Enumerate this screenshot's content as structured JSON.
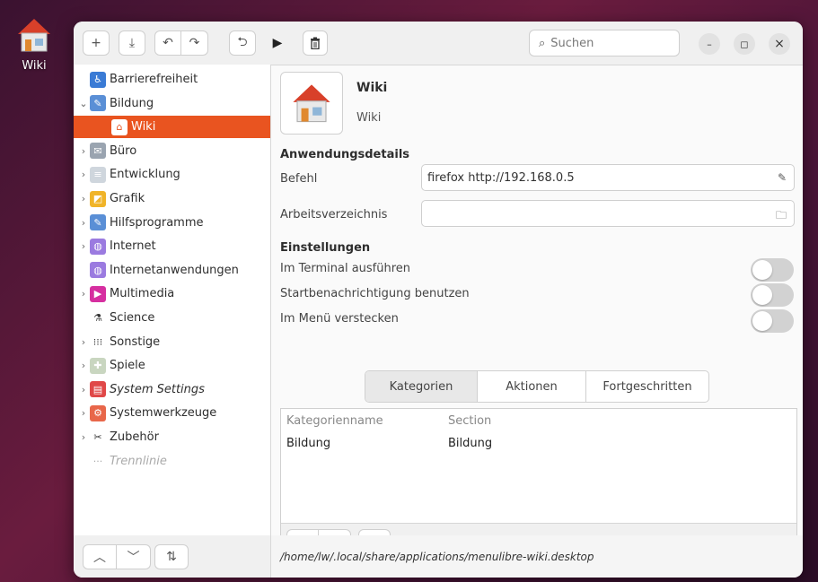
{
  "desktop": {
    "icon_label": "Wiki"
  },
  "toolbar": {
    "add": "+",
    "save": "⤓",
    "undo": "↶",
    "redo": "↷",
    "revert": "⮌",
    "run": "▶",
    "delete": "🗑",
    "search_placeholder": "Suchen",
    "minimize": "–",
    "maximize": "◻",
    "close": "×"
  },
  "sidebar": {
    "items": [
      {
        "label": "Barrierefreiheit",
        "arrow": "",
        "icon": "accessibility-icon",
        "color": "#3a7bd5",
        "glyph": "♿"
      },
      {
        "label": "Bildung",
        "arrow": "⌄",
        "icon": "education-icon",
        "color": "#5a8fd6",
        "glyph": "✎"
      },
      {
        "label": "Wiki",
        "arrow": "",
        "icon": "wiki-house-icon",
        "color": "#ffffff",
        "glyph": "⌂",
        "selected": true
      },
      {
        "label": "Büro",
        "arrow": "›",
        "icon": "office-icon",
        "color": "#9aa4b0",
        "glyph": "✉"
      },
      {
        "label": "Entwicklung",
        "arrow": "›",
        "icon": "development-icon",
        "color": "#cfd6dd",
        "glyph": "≡"
      },
      {
        "label": "Grafik",
        "arrow": "›",
        "icon": "graphics-icon",
        "color": "#f0b429",
        "glyph": "◩"
      },
      {
        "label": "Hilfsprogramme",
        "arrow": "›",
        "icon": "utilities-icon",
        "color": "#5a8fd6",
        "glyph": "✎"
      },
      {
        "label": "Internet",
        "arrow": "›",
        "icon": "internet-globe-icon",
        "color": "#9b7be0",
        "glyph": "◍"
      },
      {
        "label": "Internetanwendungen",
        "arrow": "",
        "icon": "web-apps-globe-icon",
        "color": "#9b7be0",
        "glyph": "◍"
      },
      {
        "label": "Multimedia",
        "arrow": "›",
        "icon": "multimedia-icon",
        "color": "#d62fa0",
        "glyph": "▶"
      },
      {
        "label": "Science",
        "arrow": "",
        "icon": "science-flask-icon",
        "color": "#ffffff",
        "glyph": "⚗"
      },
      {
        "label": "Sonstige",
        "arrow": "›",
        "icon": "other-grid-icon",
        "color": "#ffffff",
        "glyph": "⁝⁝⁝"
      },
      {
        "label": "Spiele",
        "arrow": "›",
        "icon": "games-icon",
        "color": "#c9d6c0",
        "glyph": "✚"
      },
      {
        "label": "System Settings",
        "arrow": "›",
        "icon": "system-settings-icon",
        "color": "#e04848",
        "glyph": "▤",
        "italic": true
      },
      {
        "label": "Systemwerkzeuge",
        "arrow": "›",
        "icon": "system-tools-icon",
        "color": "#e8674a",
        "glyph": "⚙"
      },
      {
        "label": "Zubehör",
        "arrow": "›",
        "icon": "accessories-icon",
        "color": "#ffffff",
        "glyph": "✂"
      },
      {
        "label": "Trennlinie",
        "arrow": "",
        "icon": "separator-dots-icon",
        "color": "#ffffff",
        "glyph": "···",
        "separator": true
      }
    ],
    "bottom": {
      "up": "︿",
      "down": "﹀",
      "sort": "⇅"
    }
  },
  "content": {
    "app_name": "Wiki",
    "app_comment": "Wiki",
    "details_title": "Anwendungsdetails",
    "command_label": "Befehl",
    "command_value": "firefox http://192.168.0.5",
    "workdir_label": "Arbeitsverzeichnis",
    "workdir_value": "",
    "settings_title": "Einstellungen",
    "terminal_label": "Im Terminal ausführen",
    "startup_label": "Startbenachrichtigung benutzen",
    "hide_label": "Im Menü verstecken",
    "tabs": [
      "Kategorien",
      "Aktionen",
      "Fortgeschritten"
    ],
    "table": {
      "headers": [
        "Kategorienname",
        "Section"
      ],
      "rows": [
        [
          "Bildung",
          "Bildung"
        ]
      ]
    },
    "table_buttons": {
      "add": "+",
      "remove": "−",
      "edit": "☰"
    },
    "status_path": "/home/lw/.local/share/applications/menulibre-wiki.desktop"
  }
}
